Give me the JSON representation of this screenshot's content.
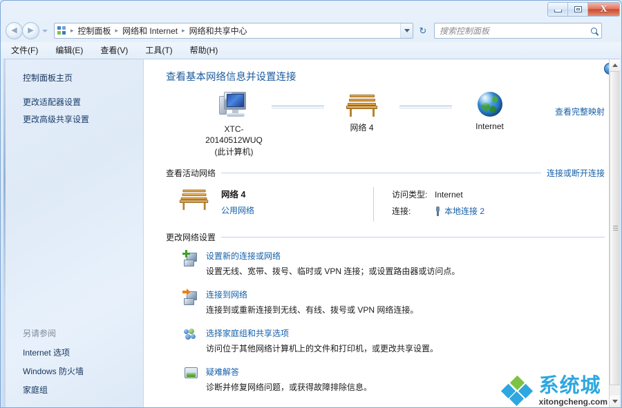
{
  "window": {
    "controls": {
      "minimize_label": "–",
      "maximize_label": "□",
      "close_label": "X"
    }
  },
  "nav": {
    "back_label": "◀",
    "forward_label": "▶",
    "history_dropdown_label": "▼",
    "breadcrumb": [
      "控制面板",
      "网络和 Internet",
      "网络和共享中心"
    ],
    "breadcrumb_separator": "▸",
    "address_dropdown_label": "▼",
    "refresh_label": "↻"
  },
  "search": {
    "placeholder": "搜索控制面板",
    "value": ""
  },
  "menubar": {
    "items": [
      "文件(F)",
      "编辑(E)",
      "查看(V)",
      "工具(T)",
      "帮助(H)"
    ]
  },
  "sidebar": {
    "home_label": "控制面板主页",
    "items": [
      "更改适配器设置",
      "更改高级共享设置"
    ],
    "see_also_title": "另请参阅",
    "see_also_items": [
      "Internet 选项",
      "Windows 防火墙",
      "家庭组"
    ]
  },
  "main": {
    "help_label": "?",
    "page_title": "查看基本网络信息并设置连接",
    "network_map": {
      "computer_name": "XTC-20140512WUQ",
      "computer_sub": "(此计算机)",
      "network_name": "网络  4",
      "internet_name": "Internet",
      "view_full_map": "查看完整映射"
    },
    "active_networks": {
      "title": "查看活动网络",
      "action": "连接或断开连接",
      "network_name": "网络  4",
      "network_type": "公用网络",
      "access_label": "访问类型:",
      "access_value": "Internet",
      "connection_label": "连接:",
      "connection_value": "本地连接 2"
    },
    "change_settings": {
      "title": "更改网络设置",
      "items": [
        {
          "link": "设置新的连接或网络",
          "desc": "设置无线、宽带、拨号、临时或 VPN 连接；或设置路由器或访问点。"
        },
        {
          "link": "连接到网络",
          "desc": "连接到或重新连接到无线、有线、拨号或 VPN 网络连接。"
        },
        {
          "link": "选择家庭组和共享选项",
          "desc": "访问位于其他网络计算机上的文件和打印机，或更改共享设置。"
        },
        {
          "link": "疑难解答",
          "desc": "诊断并修复网络问题，或获得故障排除信息。"
        }
      ]
    }
  },
  "scrollbar": {
    "up_label": "▲",
    "down_label": "▼"
  },
  "watermark": {
    "text_cn": "系统城",
    "text_en": "xitongcheng.com"
  },
  "colors": {
    "link": "#1560a8",
    "title": "#1b5b9e",
    "accent": "#2ea7e0",
    "accent_green": "#7dc242"
  }
}
